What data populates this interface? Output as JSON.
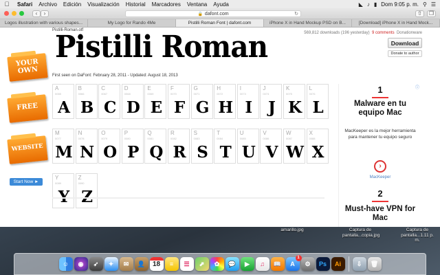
{
  "menubar": {
    "app": "Safari",
    "items": [
      "Archivo",
      "Edición",
      "Visualización",
      "Historial",
      "Marcadores",
      "Ventana",
      "Ayuda"
    ],
    "clock": "Dom 9:05 p. m."
  },
  "browser": {
    "url": "dafont.com",
    "tabs": [
      "Logos illustration with various shapes...",
      "My Logo for Rando 4Me",
      "Pistilli Roman Font | dafont.com",
      "iPhone X in Hand Mockup PSD on B...",
      "[Download] iPhone X in Hand Mock..."
    ],
    "active_tab": 2
  },
  "page": {
    "file": "Pistilli-Roman.otf",
    "title": "Pistilli Roman",
    "stats": "569,812 downloads (196 yesterday)",
    "comments": "9 comments",
    "donationware": "Donationware",
    "download_label": "Download",
    "donate_label": "Donate to author",
    "first_seen": "First seen on DaFont: February 28, 2011 - Updated: August 18, 2013",
    "promos": [
      "YOUR OWN",
      "FREE",
      "WEBSITE"
    ],
    "start_now": "Start Now ►",
    "glyphs": [
      {
        "ch": "A",
        "code": "0065"
      },
      {
        "ch": "B",
        "code": "0066"
      },
      {
        "ch": "C",
        "code": "0067"
      },
      {
        "ch": "D",
        "code": "0068"
      },
      {
        "ch": "E",
        "code": "0069"
      },
      {
        "ch": "F",
        "code": "0070"
      },
      {
        "ch": "G",
        "code": "0071"
      },
      {
        "ch": "H",
        "code": "0072"
      },
      {
        "ch": "I",
        "code": "0073"
      },
      {
        "ch": "J",
        "code": "0074"
      },
      {
        "ch": "K",
        "code": "0075"
      },
      {
        "ch": "L",
        "code": "0076"
      },
      {
        "ch": "M",
        "code": "0077"
      },
      {
        "ch": "N",
        "code": "0078"
      },
      {
        "ch": "O",
        "code": "0079"
      },
      {
        "ch": "P",
        "code": "0080"
      },
      {
        "ch": "Q",
        "code": "0081"
      },
      {
        "ch": "R",
        "code": "0082"
      },
      {
        "ch": "S",
        "code": "0083"
      },
      {
        "ch": "T",
        "code": "0084"
      },
      {
        "ch": "U",
        "code": "0085"
      },
      {
        "ch": "V",
        "code": "0086"
      },
      {
        "ch": "W",
        "code": "0087"
      },
      {
        "ch": "X",
        "code": "0088"
      },
      {
        "ch": "Y",
        "code": "0089"
      },
      {
        "ch": "Z",
        "code": "0090"
      }
    ]
  },
  "ad": {
    "num1": "1",
    "head1": "Malware en tu equipo Mac",
    "sub1": "MacKeeper es la mejor herramienta para mantener tu equipo seguro",
    "brand": "MacKeeper",
    "num2": "2",
    "head2": "Must-have VPN for Mac"
  },
  "desktop": {
    "files": [
      "Captura de pantalla...copia.jpg",
      "amarillo.jpg",
      "Captura de pantalla...1.11 p. m."
    ]
  },
  "dock": {
    "badge": "1",
    "calendar_day": "18",
    "icons": [
      "finder-icon",
      "siri-icon",
      "launchpad-icon",
      "safari-icon",
      "mail-icon",
      "contacts-icon",
      "calendar-icon",
      "notes-icon",
      "reminders-icon",
      "maps-icon",
      "photos-icon",
      "messages-icon",
      "facetime-icon",
      "itunes-icon",
      "ibooks-icon",
      "app-store-icon",
      "preferences-icon",
      "photoshop-icon",
      "illustrator-icon",
      "downloads-icon",
      "trash-icon"
    ],
    "colors": {
      "finder": "#3b8fe0",
      "safari": "#2b8ef0",
      "photoshop": "#0b1a3a",
      "illustrator": "#3a1a00",
      "accent": "#e86b00"
    }
  }
}
